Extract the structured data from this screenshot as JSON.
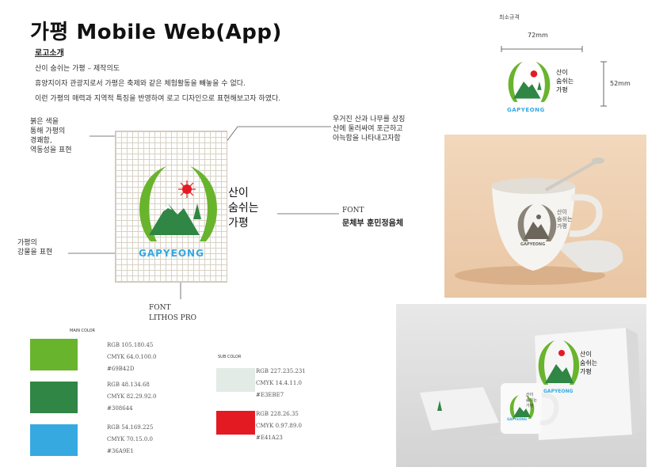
{
  "title": "가평 Mobile Web(App)",
  "section_title": "로고소개",
  "intro": [
    "산이 숨쉬는 가평 – 제작의도",
    "휴양지이자 관광지로서 가평은 축제와 같은 체험활동을 빼놓을 수 없다.",
    "이런 가평의 매력과 지역적 특징을 반영하여 로고 디자인으로 표현해보고자 하였다."
  ],
  "annotations": {
    "red": "붉은 색을\n통해 가평의\n경쾌함,\n역동성을 표현",
    "river": "가평의\n강물을 표현",
    "arc": "우거진 산과 나무를 상징\n산에 둘러싸여 포근하고\n아늑함을 나타내고자함"
  },
  "logo": {
    "text_line1": "산이",
    "text_line2": "숨쉬는",
    "text_line3": "가평",
    "wordmark": "GAPYEONG"
  },
  "font_korean": {
    "label": "FONT",
    "name": "문체부 훈민정음체"
  },
  "font_english": {
    "label": "FONT",
    "name": "LITHOS PRO"
  },
  "min_size": {
    "label": "최소규격",
    "width": "72mm",
    "height": "52mm"
  },
  "main_color_label": "MAIN COLOR",
  "sub_color_label": "SUB COLOR",
  "main_colors": [
    {
      "hex": "#69B42D",
      "rgb": "RGB 105.180.45",
      "cmyk": "CMYK 64.0.100.0",
      "code": "#69B42D"
    },
    {
      "hex": "#308644",
      "rgb": "RGB 48.134.68",
      "cmyk": "CMYK 82.29.92.0",
      "code": "#308644"
    },
    {
      "hex": "#36A9E1",
      "rgb": "RGB 54.169.225",
      "cmyk": "CMYK 70.15.0.0",
      "code": "#36A9E1"
    }
  ],
  "sub_colors": [
    {
      "hex": "#E3EBE7",
      "rgb": "RGB 227.235.231",
      "cmyk": "CMYK 14.4.11.0",
      "code": "#E3EBE7"
    },
    {
      "hex": "#E41A23",
      "rgb": "RGB 228.26.35",
      "cmyk": "CMYK 0.97.89.0",
      "code": "#E41A23"
    }
  ]
}
